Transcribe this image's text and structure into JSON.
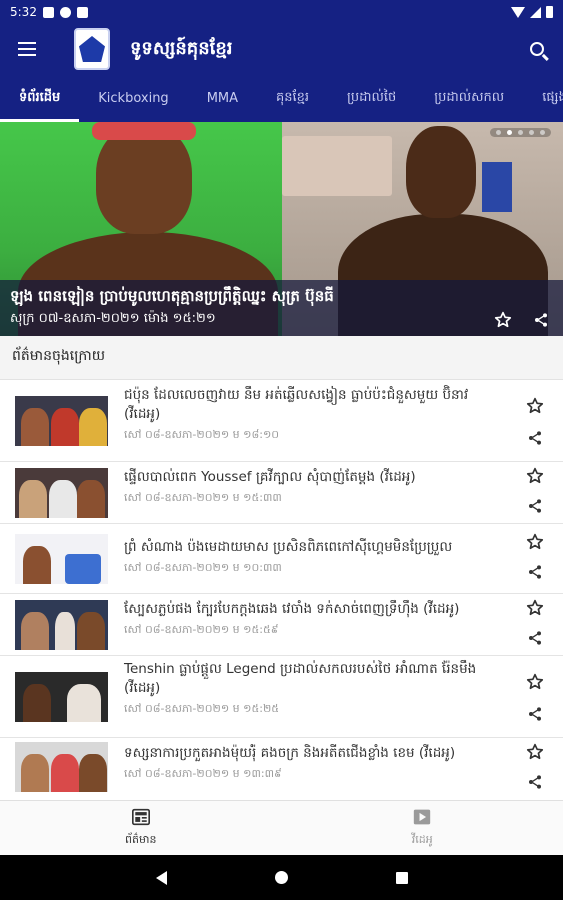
{
  "status_bar": {
    "time": "5:32"
  },
  "app_bar": {
    "title": "ទូទស្សន៍គុនខ្មែរ"
  },
  "tabs": [
    {
      "label": "ទំព័រដើម"
    },
    {
      "label": "Kickboxing"
    },
    {
      "label": "MMA"
    },
    {
      "label": "គុនខ្មែរ"
    },
    {
      "label": "ប្រដាល់ថៃ"
    },
    {
      "label": "ប្រដាល់សកល"
    },
    {
      "label": "ផ្សេងៗ"
    }
  ],
  "hero": {
    "title": "ឡុង ពេនឡៀន ប្រាប់មូលហេតុគ្មានប្រព្រឹត្តិឈ្នះ សុត្រ ប៊ុនធី",
    "date": "សុក្រ ០៧-ឧសភា-២០២១ ម៉ោង ១៥:២១"
  },
  "section_header": "ព័ត៌មានចុងក្រោយ",
  "news": [
    {
      "title": "ជប៉ុន ដែលលេចញវាយ នឹម អត់ឆ្លើលសង្វៀន ធ្លាប់ប៉ះជំនួសមួយ ប៊ិនាវ (វីដេអូ)",
      "date": "សៅ ០៨-ឧសភា-២០២១ ម ១៨:១០"
    },
    {
      "title": "ផ្ទើលបាល់ពេក Youssef គ្រវីក្បាល សុំបាញ់តែម្តង (វីដេអូ)",
      "date": "សៅ ០៨-ឧសភា-២០២១ ម ១៥:៣៣"
    },
    {
      "title": "ព្រំ សំណាង ប៉ងមេដាយមាស ប្រសិនពិភពេកៅស៊ីហ្គេមមិនប្រែប្រួល",
      "date": "សៅ ០៨-ឧសភា-២០២១ ម ១០:៣៣"
    },
    {
      "title": "ស្បែសភ្លប់ផង ក្បែរបែកក្តងឆេង វេចាំង ទក់សាច់ពេញទ្រឹហ៊ឹង (វីដេអូ)",
      "date": "សៅ ០៨-ឧសភា-២០២១ ម ១៥:៥៩"
    },
    {
      "title": "Tenshin ធ្លាប់ផ្តួល Legend ប្រដាល់សកលរបស់ថៃ អាំណាត រ៉ែនមឹង (វីដេអូ)",
      "date": "សៅ ០៨-ឧសភា-២០២១ ម ១៥:២៥"
    },
    {
      "title": "ទស្សនាការប្រកួតអាងម៉ុយរ៉ុំ គងចក្រ និងអតីតជើងខ្លាំង ខេម (វីដេអូ)",
      "date": "សៅ ០៨-ឧសភា-២០២១ ម ១៣:៣៩"
    }
  ],
  "bottom_nav": [
    {
      "label": "ព័ត៌មាន"
    },
    {
      "label": "វីដេអូ"
    }
  ],
  "colors": {
    "primary": "#152183",
    "accent": "#ffffff"
  }
}
